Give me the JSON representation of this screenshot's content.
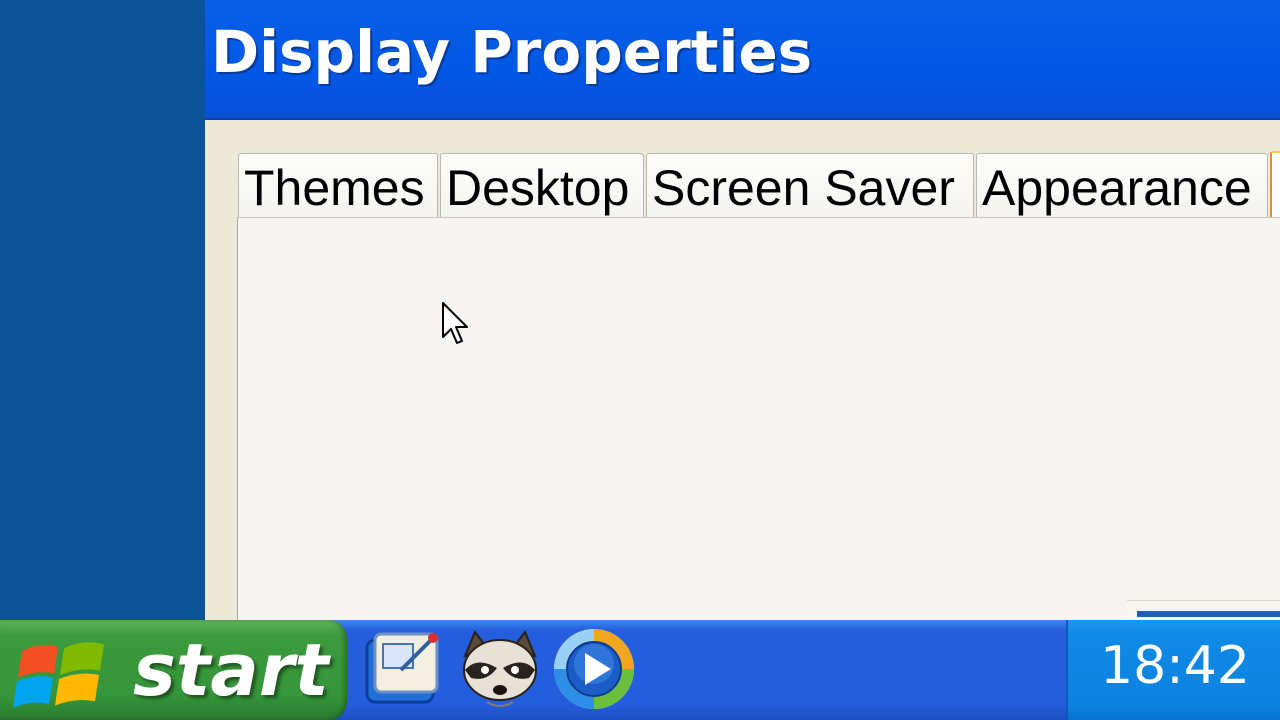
{
  "window": {
    "title": "Display Properties",
    "tabs": [
      {
        "label": "Themes"
      },
      {
        "label": "Desktop"
      },
      {
        "label": "Screen Saver"
      },
      {
        "label": "Appearance"
      }
    ]
  },
  "taskbar": {
    "start_label": "start",
    "quick_launch": [
      {
        "icon": "show-desktop-icon"
      },
      {
        "icon": "raccoon-app-icon"
      },
      {
        "icon": "windows-media-player-icon"
      }
    ],
    "clock": "18:42"
  },
  "colors": {
    "desktop": "#0b5296",
    "titlebar": "#0058e6",
    "taskbar": "#245edc",
    "start_button": "#3c9a3c",
    "tray": "#0c82e0",
    "window_body": "#ece9d8"
  }
}
